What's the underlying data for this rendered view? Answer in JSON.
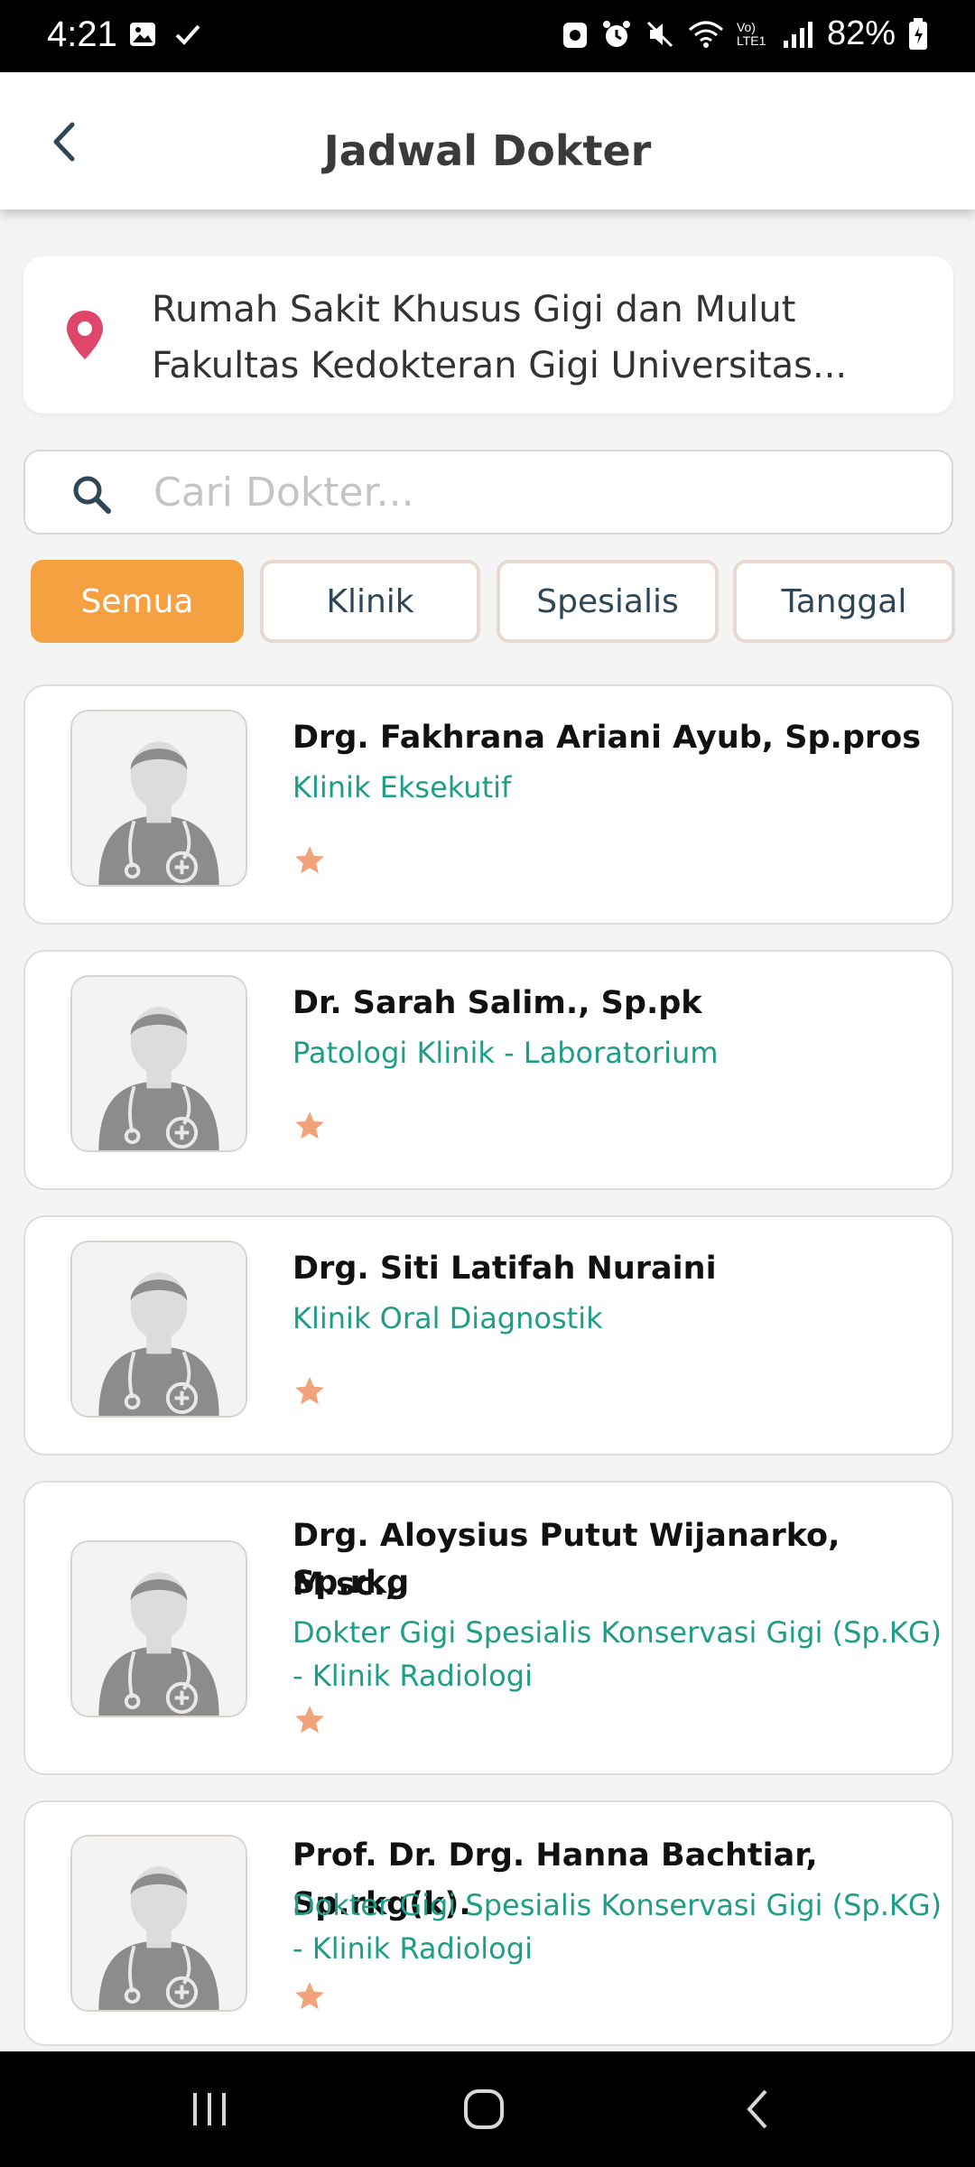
{
  "status_bar": {
    "time": "4:21",
    "battery_pct": "82%",
    "network_label": "Vo) LTE1"
  },
  "header": {
    "title": "Jadwal Dokter"
  },
  "location": {
    "line1": "Rumah Sakit Khusus Gigi dan Mulut",
    "line2": "Fakultas Kedokteran Gigi Universitas..."
  },
  "search": {
    "placeholder": "Cari Dokter..."
  },
  "filters": [
    {
      "label": "Semua",
      "active": true
    },
    {
      "label": "Klinik",
      "active": false
    },
    {
      "label": "Spesialis",
      "active": false
    },
    {
      "label": "Tanggal",
      "active": false
    }
  ],
  "doctors": [
    {
      "name": "Drg. Fakhrana Ariani Ayub, Sp.pros",
      "dept": "Klinik Eksekutif"
    },
    {
      "name": "Dr. Sarah Salim., Sp.pk",
      "dept": "Patologi Klinik - Laboratorium"
    },
    {
      "name": "Drg. Siti Latifah Nuraini",
      "dept": "Klinik Oral Diagnostik"
    },
    {
      "name_line1": "Drg. Aloysius Putut Wijanarko, M.sc.,",
      "name_line2": "Sp.rkg",
      "dept_line1": "Dokter Gigi Spesialis Konservasi Gigi (Sp.KG)",
      "dept_line2": "- Klinik Radiologi"
    },
    {
      "name": "Prof. Dr. Drg. Hanna Bachtiar, Sp.rkg(k).",
      "dept_line1": "Dokter Gigi Spesialis Konservasi Gigi (Sp.KG)",
      "dept_line2": "- Klinik Radiologi"
    }
  ],
  "colors": {
    "accent": "#f5a142",
    "dept_text": "#1f9e87",
    "star": "#f0a27a",
    "pin": "#e0466a"
  },
  "icons": [
    "back-arrow-icon",
    "location-pin-icon",
    "search-icon",
    "star-icon",
    "doctor-avatar-icon"
  ]
}
